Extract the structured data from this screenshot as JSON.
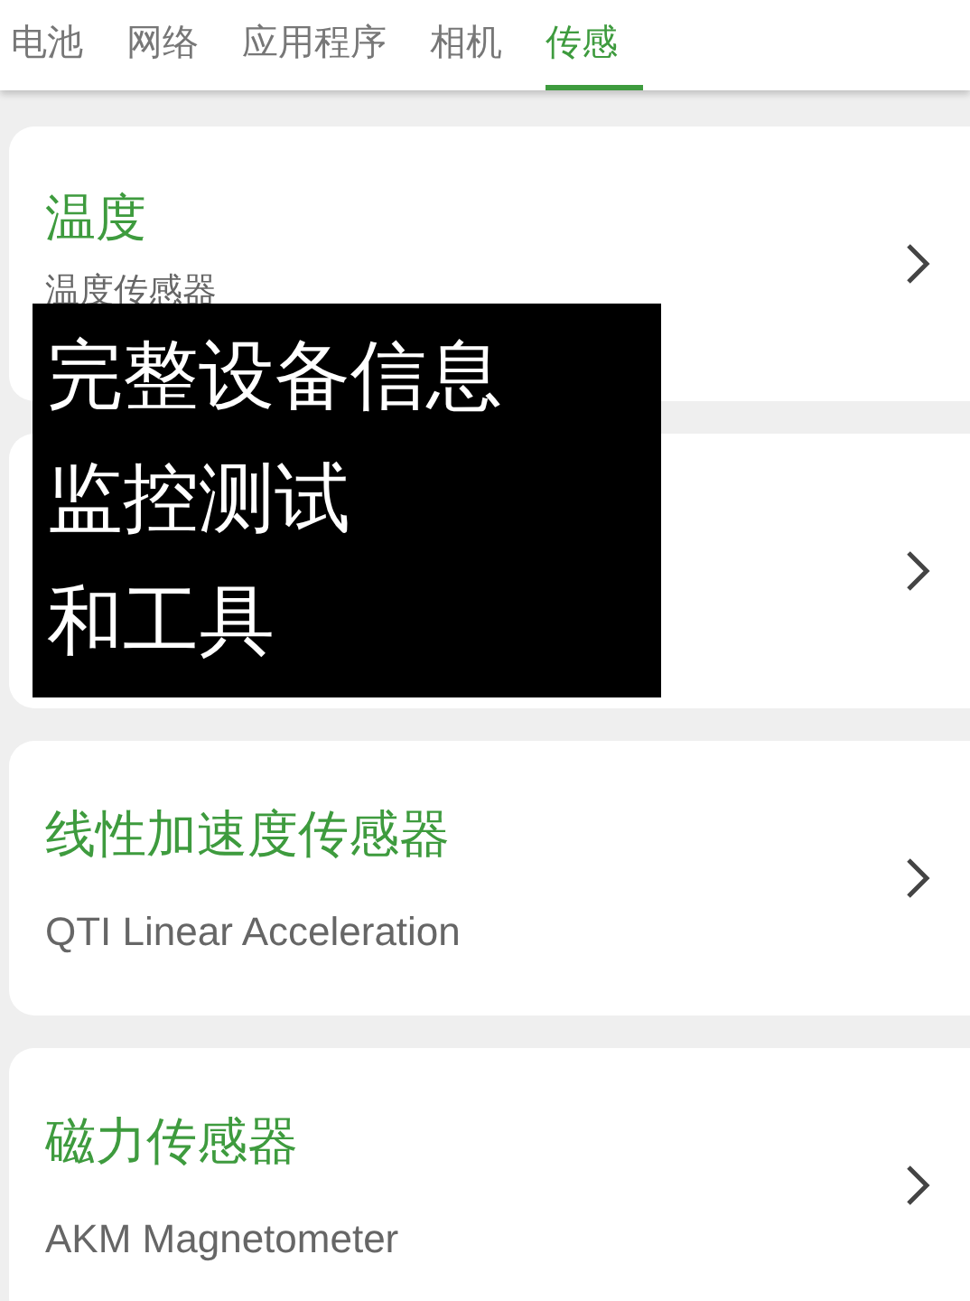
{
  "tabs": [
    {
      "label": "电池",
      "selected": false
    },
    {
      "label": "网络",
      "selected": false
    },
    {
      "label": "应用程序",
      "selected": false
    },
    {
      "label": "相机",
      "selected": false
    },
    {
      "label": "传感",
      "selected": true
    }
  ],
  "sensors": [
    {
      "kind": "sensor",
      "title": "温度",
      "subtitle": "温度传感器"
    },
    {
      "kind": "covered"
    },
    {
      "kind": "sensor",
      "title": "线性加速度传感器",
      "subtitle": "QTI Linear Acceleration"
    },
    {
      "kind": "sensor",
      "title": "磁力传感器",
      "subtitle": "AKM Magnetometer"
    }
  ],
  "overlay": {
    "lines": [
      "完整设备信息",
      "监控测试",
      "和工具"
    ]
  }
}
